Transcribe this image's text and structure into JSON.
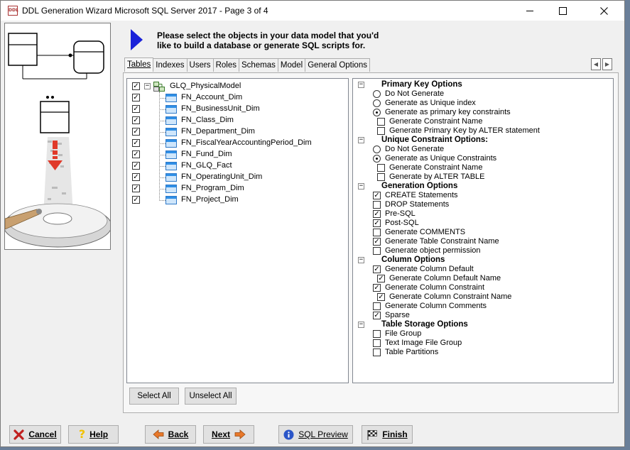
{
  "window": {
    "title": "DDL Generation Wizard Microsoft SQL Server 2017 - Page 3 of 4",
    "app_icon_text": "DDL"
  },
  "instruction": {
    "line1": "Please select the objects in your data model that you'd",
    "line2": "like to build a database or generate SQL scripts for."
  },
  "tabs": [
    {
      "label": "Tables",
      "active": true
    },
    {
      "label": "Indexes"
    },
    {
      "label": "Users"
    },
    {
      "label": "Roles"
    },
    {
      "label": "Schemas"
    },
    {
      "label": "Model"
    },
    {
      "label": "General Options"
    }
  ],
  "tree": {
    "root": {
      "label": "GLQ_PhysicalModel",
      "checked": true,
      "expander": "−"
    },
    "items": [
      {
        "label": "FN_Account_Dim",
        "checked": true
      },
      {
        "label": "FN_BusinessUnit_Dim",
        "checked": true
      },
      {
        "label": "FN_Class_Dim",
        "checked": true
      },
      {
        "label": "FN_Department_Dim",
        "checked": true
      },
      {
        "label": "FN_FiscalYearAccountingPeriod_Dim",
        "checked": true
      },
      {
        "label": "FN_Fund_Dim",
        "checked": true
      },
      {
        "label": "FN_GLQ_Fact",
        "checked": true
      },
      {
        "label": "FN_OperatingUnit_Dim",
        "checked": true
      },
      {
        "label": "FN_Program_Dim",
        "checked": true
      },
      {
        "label": "FN_Project_Dim",
        "checked": true
      }
    ]
  },
  "options": {
    "expander_symbol": "−",
    "check_mark": "✓",
    "rows": [
      {
        "type": "header",
        "label": "Primary Key Options"
      },
      {
        "type": "radio",
        "label": "Do Not Generate",
        "checked": false,
        "indent": 0
      },
      {
        "type": "radio",
        "label": "Generate as Unique index",
        "checked": false,
        "indent": 0
      },
      {
        "type": "radio",
        "label": "Generate as primary key constraints",
        "checked": true,
        "indent": 0
      },
      {
        "type": "check",
        "label": "Generate Constraint Name",
        "checked": false,
        "indent": 1
      },
      {
        "type": "check",
        "label": "Generate Primary Key by ALTER statement",
        "checked": false,
        "indent": 1
      },
      {
        "type": "header",
        "label": "Unique Constraint Options:"
      },
      {
        "type": "radio",
        "label": "Do Not Generate",
        "checked": false,
        "indent": 0
      },
      {
        "type": "radio",
        "label": "Generate as Unique Constraints",
        "checked": true,
        "indent": 0
      },
      {
        "type": "check",
        "label": "Generate Constraint Name",
        "checked": false,
        "indent": 1
      },
      {
        "type": "check",
        "label": "Generate by ALTER TABLE",
        "checked": false,
        "indent": 1
      },
      {
        "type": "header",
        "label": "Generation Options"
      },
      {
        "type": "check",
        "label": "CREATE Statements",
        "checked": true,
        "indent": 0
      },
      {
        "type": "check",
        "label": "DROP Statements",
        "checked": false,
        "indent": 0
      },
      {
        "type": "check",
        "label": "Pre-SQL",
        "checked": true,
        "indent": 0
      },
      {
        "type": "check",
        "label": "Post-SQL",
        "checked": true,
        "indent": 0
      },
      {
        "type": "check",
        "label": "Generate COMMENTS",
        "checked": false,
        "indent": 0
      },
      {
        "type": "check",
        "label": "Generate Table Constraint Name",
        "checked": true,
        "indent": 0
      },
      {
        "type": "check",
        "label": "Generate object permission",
        "checked": false,
        "indent": 0
      },
      {
        "type": "header",
        "label": "Column Options"
      },
      {
        "type": "check",
        "label": "Generate Column Default",
        "checked": true,
        "indent": 0
      },
      {
        "type": "check",
        "label": "Generate Column Default Name",
        "checked": true,
        "indent": 1
      },
      {
        "type": "check",
        "label": "Generate Column Constraint",
        "checked": true,
        "indent": 0
      },
      {
        "type": "check",
        "label": "Generate Column Constraint Name",
        "checked": true,
        "indent": 1
      },
      {
        "type": "check",
        "label": "Generate Column Comments",
        "checked": false,
        "indent": 0
      },
      {
        "type": "check",
        "label": "Sparse",
        "checked": true,
        "indent": 0
      },
      {
        "type": "header",
        "label": "Table Storage Options"
      },
      {
        "type": "check",
        "label": "File Group",
        "checked": false,
        "indent": 0
      },
      {
        "type": "check",
        "label": "Text Image File Group",
        "checked": false,
        "indent": 0
      },
      {
        "type": "check",
        "label": "Table Partitions",
        "checked": false,
        "indent": 0
      }
    ]
  },
  "buttons": {
    "select_all": "Select All",
    "unselect_all": "Unselect All",
    "cancel": "Cancel",
    "help": "Help",
    "back": "Back",
    "next": "Next",
    "sql_preview": "SQL Preview",
    "finish": "Finish"
  },
  "colors": {
    "accent_arrow": "#1a22d9",
    "cancel_icon": "#c0201f",
    "nav_arrow": "#e8782a",
    "help_icon": "#f2c200",
    "preview_icon": "#2a55c8"
  }
}
